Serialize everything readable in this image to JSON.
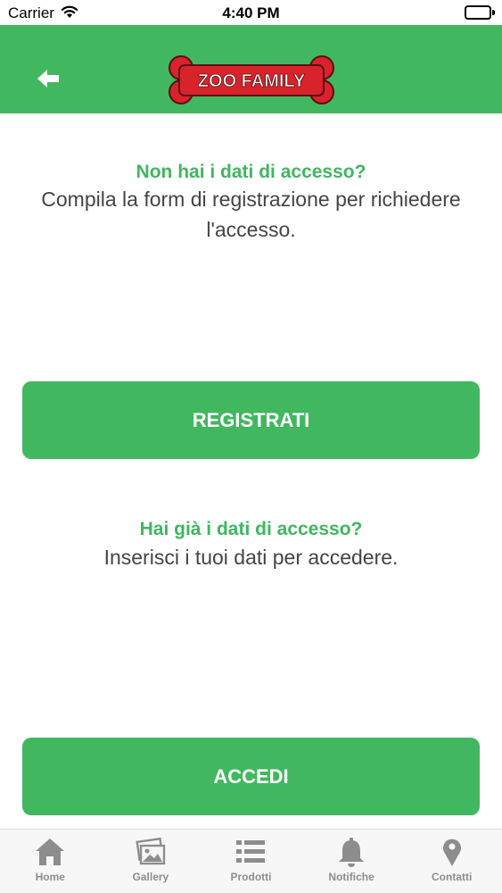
{
  "status_bar": {
    "carrier": "Carrier",
    "time": "4:40 PM"
  },
  "header": {
    "logo_text": "ZOO FAMILY",
    "background_color": "#41b85f",
    "back_icon": "arrow-left-icon"
  },
  "register_section": {
    "title": "Non hai i dati di accesso?",
    "description": "Compila la form di registrazione per richiedere l'accesso.",
    "button_label": "REGISTRATI"
  },
  "login_section": {
    "title": "Hai già i dati di accesso?",
    "description": "Inserisci i tuoi dati per accedere.",
    "button_label": "ACCEDI"
  },
  "tab_bar": {
    "items": [
      {
        "label": "Home",
        "icon": "home-icon"
      },
      {
        "label": "Gallery",
        "icon": "gallery-icon"
      },
      {
        "label": "Prodotti",
        "icon": "list-icon"
      },
      {
        "label": "Notifiche",
        "icon": "bell-icon"
      },
      {
        "label": "Contatti",
        "icon": "map-pin-icon"
      }
    ]
  },
  "colors": {
    "accent": "#41b85f",
    "logo_bone": "#d9232a",
    "tab_icon": "#8d8d8d"
  }
}
